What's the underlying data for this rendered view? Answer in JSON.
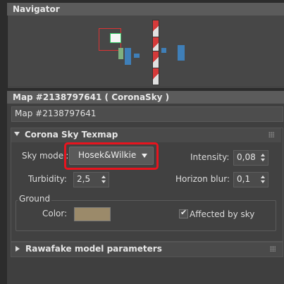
{
  "navigator": {
    "title": "Navigator"
  },
  "material": {
    "title": "Map #2138797641  ( CoronaSky )",
    "name": "Map #2138797641",
    "rollout_title": "Corona Sky Texmap",
    "sky_model_label": "Sky model:",
    "sky_model_value": "Hosek&Wilkie",
    "intensity_label": "Intensity:",
    "intensity_value": "0,08",
    "turbidity_label": "Turbidity:",
    "turbidity_value": "2,5",
    "horizon_blur_label": "Horizon blur:",
    "horizon_blur_value": "0,1",
    "ground_label": "Ground",
    "color_label": "Color:",
    "ground_color": "#9b8a6a",
    "affected_label": "Affected by sky",
    "affected_checked": true,
    "rollout2_title": "Rawafake model parameters"
  },
  "colors": {
    "highlight": "#e8141e",
    "panel_bg": "#3f3f3f",
    "title_bar": "#5b5b5b"
  }
}
